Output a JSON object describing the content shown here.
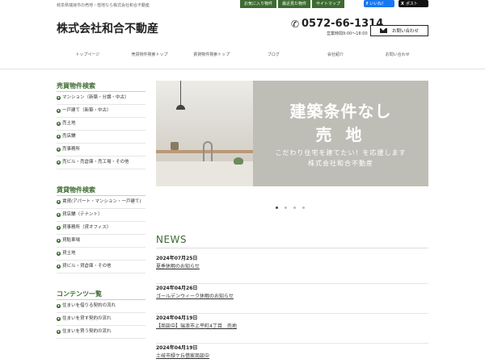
{
  "header": {
    "tagline": "岐阜県瑞浪市の売地・借地なら株式会社和合不動産",
    "top_buttons": [
      "お気に入り物件",
      "最近見た物件",
      "サイトマップ"
    ],
    "fb_label": "いいね！",
    "fb_glyph": "f",
    "tw_label": "ポスト",
    "tw_glyph": "X",
    "site_title": "株式会社和合不動産",
    "phone_glyph": "✆",
    "phone": "0572-66-1314",
    "hours": "営業時間9:00～18:00",
    "contact_label": "お問い合わせ"
  },
  "nav": [
    "トップページ",
    "売買物件検索トップ",
    "賃貸物件検索トップ",
    "ブログ",
    "会社紹介",
    "お問い合わせ"
  ],
  "sidebar": {
    "sale_heading": "売買物件検索",
    "sale_items": [
      "マンション（新築・分譲・中古）",
      "一戸建て（新築・中古）",
      "売土地",
      "売店舗",
      "売事務所",
      "売ビル・売倉庫・売工場・その他"
    ],
    "rent_heading": "賃貸物件検索",
    "rent_items": [
      "賃貸(アパート・マンション・一戸建て)",
      "貸店舗（テナント）",
      "貸事務所（貸オフィス）",
      "貸駐車場",
      "貸土地",
      "貸ビル・貸倉庫・その他"
    ],
    "contents_heading": "コンテンツ一覧",
    "contents_items": [
      "住まいを借りる契約の流れ",
      "住まいを貸す契約の流れ",
      "住まいを買う契約の流れ"
    ]
  },
  "banner": {
    "headline_1": "建築条件なし",
    "headline_2": "売 地",
    "sub_1": "こだわり住宅を建てたい！を応援します",
    "sub_2": "株式会社和合不動産"
  },
  "slider": {
    "count": 4,
    "active": 0
  },
  "news": {
    "heading": "NEWS",
    "items": [
      {
        "date": "2024年07月25日",
        "title": "夏季休暇のお知らせ"
      },
      {
        "date": "2024年04月26日",
        "title": "ゴールデンウィーク休暇のお知らせ"
      },
      {
        "date": "2024年04月19日",
        "title": "【商談中】瑞浪市上平町4丁目　売地"
      },
      {
        "date": "2024年04月19日",
        "title": "土岐市緑ケ丘借家商談中"
      }
    ]
  },
  "colors": {
    "accent": "#3d6b32",
    "facebook": "#1877f2",
    "x": "#111111"
  }
}
